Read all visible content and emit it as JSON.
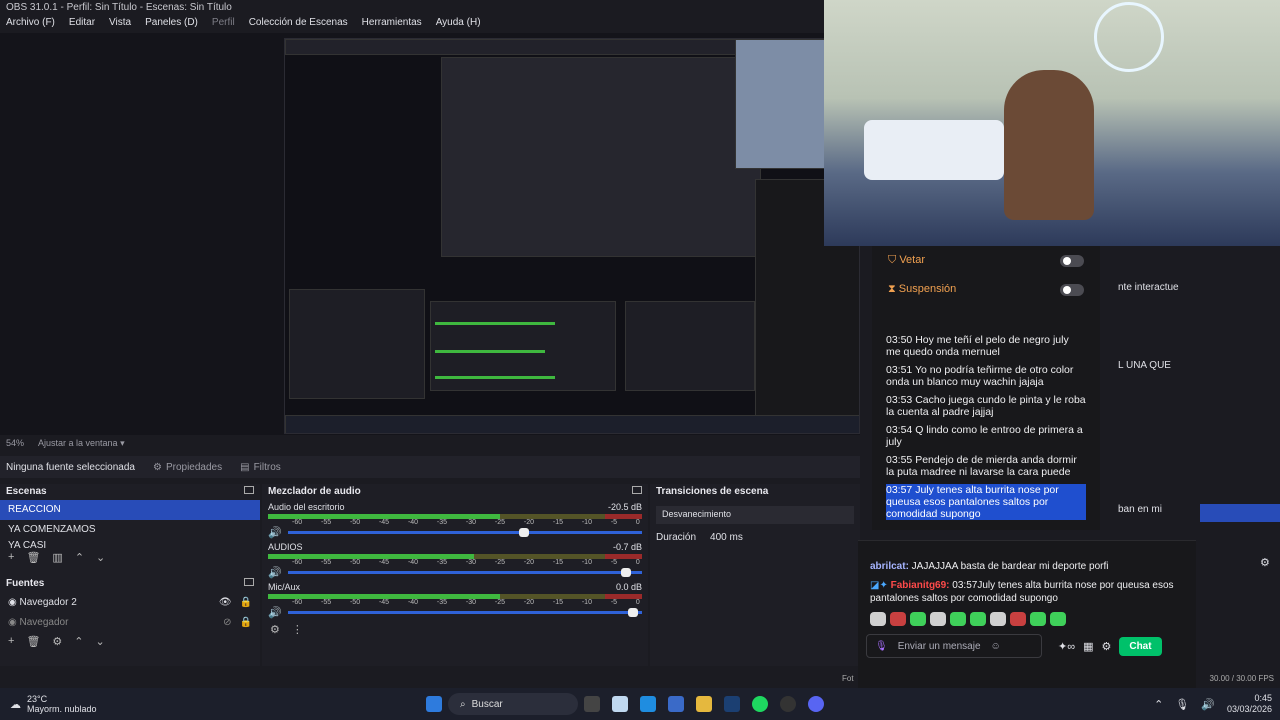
{
  "window": {
    "title": "OBS 31.0.1 - Perfil: Sin Título - Escenas: Sin Título"
  },
  "menu": [
    {
      "label": "Archivo (F)",
      "dim": false
    },
    {
      "label": "Editar",
      "dim": false
    },
    {
      "label": "Vista",
      "dim": false
    },
    {
      "label": "Paneles (D)",
      "dim": false
    },
    {
      "label": "Perfil",
      "dim": true
    },
    {
      "label": "Colección de Escenas",
      "dim": false
    },
    {
      "label": "Herramientas",
      "dim": false
    },
    {
      "label": "Ayuda (H)",
      "dim": false
    }
  ],
  "preview": {
    "zoom": "54%",
    "fit_label": "Ajustar a la ventana"
  },
  "source_toolbar": {
    "no_source": "Ninguna fuente seleccionada",
    "properties": "Propiedades",
    "filters": "Filtros"
  },
  "scenes": {
    "title": "Escenas",
    "items": [
      {
        "label": "REACCION",
        "selected": true
      },
      {
        "label": "YA COMENZAMOS",
        "selected": false
      },
      {
        "label": "YA CASI",
        "selected": false
      }
    ]
  },
  "sources": {
    "title": "Fuentes",
    "items": [
      {
        "label": "Navegador 2",
        "visible": true
      },
      {
        "label": "Navegador",
        "visible": false
      }
    ]
  },
  "mixer": {
    "title": "Mezclador de audio",
    "channels": [
      {
        "name": "Audio del escritorio",
        "db": "-20.5 dB",
        "level": 0.62,
        "volume": 0.68
      },
      {
        "name": "AUDIOS",
        "db": "-0.7 dB",
        "level": 0.55,
        "volume": 0.97
      },
      {
        "name": "Mic/Aux",
        "db": "0.0 dB",
        "level": 0.62,
        "volume": 0.99
      }
    ],
    "ticks": [
      "-60",
      "-55",
      "-50",
      "-45",
      "-40",
      "-35",
      "-30",
      "-25",
      "-20",
      "-15",
      "-10",
      "-5",
      "0"
    ]
  },
  "transitions": {
    "title": "Transiciones de escena",
    "selected": "Desvanecimiento",
    "duration_label": "Duración",
    "duration_value": "400 ms"
  },
  "moderation": {
    "veto": "Vetar",
    "suspension": "Suspensión"
  },
  "chat_log": [
    {
      "text": "03:50 Hoy me teñí el pelo de negro july me quedo onda mernuel",
      "hl": false
    },
    {
      "text": "03:51 Yo no podría teñirme de otro color onda un blanco muy wachin jajaja",
      "hl": false
    },
    {
      "text": "03:53 Cacho juega cundo le pinta y le roba la cuenta al padre jajjaj",
      "hl": false
    },
    {
      "text": "03:54 Q lindo como le entroo de primera a july",
      "hl": false
    },
    {
      "text": "03:55 Pendejo de de mierda anda dormir la puta madree ni lavarse la cara puede",
      "hl": false
    },
    {
      "text": "03:57 July tenes alta burrita nose por queusa esos pantalones saltos por comodidad supongo",
      "hl": true
    }
  ],
  "chat": {
    "msg1_user": "abrilcat:",
    "msg1_text": " JAJAJJAA basta de bardear mi deporte porfi",
    "msg2_user": "Fabianitg69:",
    "msg2_text": " 03:57July tenes alta burrita nose por queusa esos pantalones saltos por comodidad supongo",
    "input_placeholder": "Enviar un mensaje",
    "send_label": "Chat"
  },
  "right_partial": {
    "line1": "nte interactue",
    "line2": "L UNA QUE",
    "line3": "ban en mi"
  },
  "status": {
    "fps": "30.00 / 30.00 FPS",
    "fot": "Fot"
  },
  "taskbar": {
    "weather_temp": "23°C",
    "weather_desc": "Mayorm. nublado",
    "search": "Buscar",
    "time": "0:45",
    "date": "03/03/2026"
  },
  "colors": {
    "accent": "#284cb8",
    "chat_green": "#00c16a",
    "meter_green": "#3fb83f"
  }
}
